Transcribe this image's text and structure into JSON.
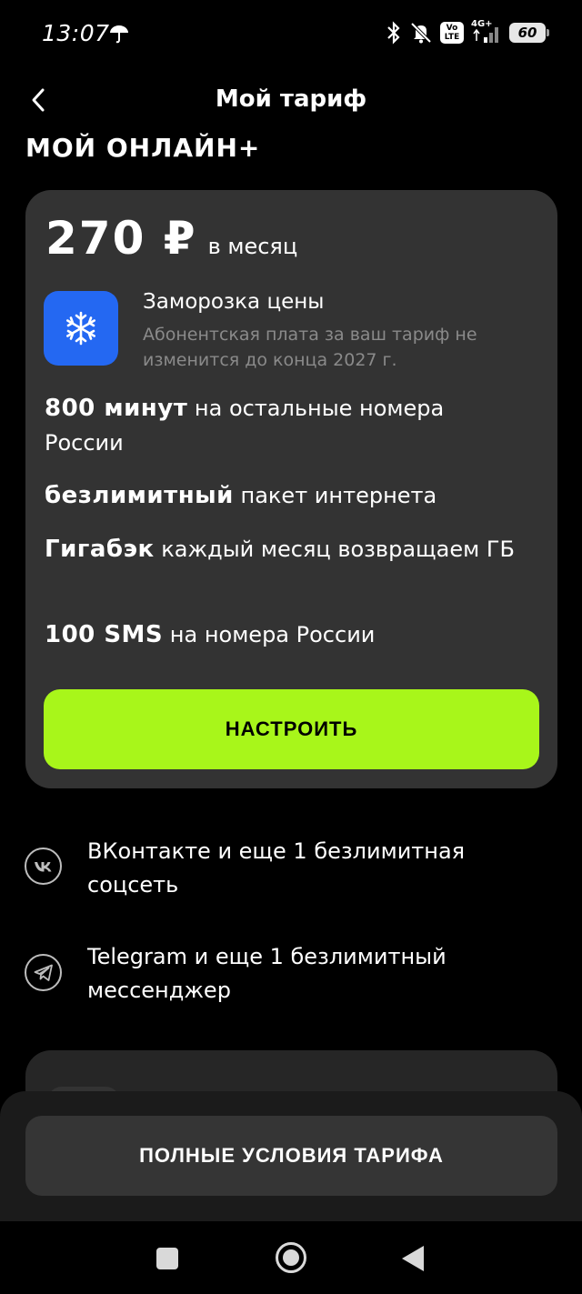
{
  "status_bar": {
    "time": "13:07",
    "network": "4G+",
    "volte": "Vo LTE",
    "battery": "60"
  },
  "header": {
    "title": "Мой тариф",
    "back_icon": "chevron-left-icon"
  },
  "tariff": {
    "name": "МОЙ ОНЛАЙН+",
    "price": "270 ₽",
    "period": "в месяц",
    "freeze": {
      "icon": "snowflake-icon",
      "title": "Заморозка цены",
      "description": "Абонентская плата за ваш тариф не изменится до конца 2027 г."
    },
    "features": [
      {
        "bold": "800 минут",
        "text": "на остальные номера России"
      },
      {
        "bold": "безлимитный",
        "text": "пакет интернета"
      },
      {
        "bold": "Гигабэк",
        "text": "каждый месяц возвращаем ГБ"
      },
      {
        "bold": "100 SMS",
        "text": "на номера России"
      }
    ],
    "configure_label": "НАСТРОИТЬ"
  },
  "social": [
    {
      "icon": "vk-icon",
      "text": "ВКонтакте и еще 1 безлимитная соцсеть"
    },
    {
      "icon": "telegram-icon",
      "text": "Telegram и еще 1 безлимитный мессенджер"
    }
  ],
  "bottom": {
    "full_terms_label": "ПОЛНЫЕ УСЛОВИЯ ТАРИФА"
  },
  "colors": {
    "background": "#000000",
    "card": "#333333",
    "accent": "#a8f61a",
    "freeze_icon_bg": "#2468f2",
    "muted_text": "#8a8a8a"
  }
}
